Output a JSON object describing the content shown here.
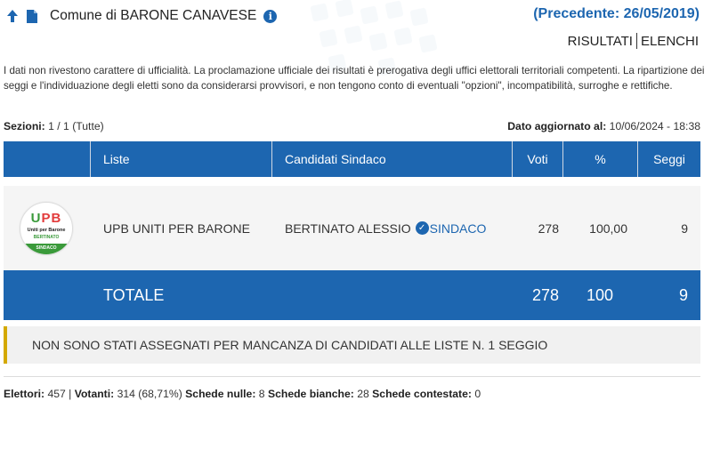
{
  "header": {
    "municipality_prefix": "Comune di",
    "municipality_name": "BARONE CANAVESE",
    "previous_label": "(Precedente: 26/05/2019)",
    "tabs": [
      {
        "label": "RISULTATI",
        "active": true
      },
      {
        "label": "ELENCHI",
        "active": false
      }
    ]
  },
  "disclaimer": "I dati non rivestono carattere di ufficialità. La proclamazione ufficiale dei risultati è prerogativa degli uffici elettorali territoriali competenti. La ripartizione dei seggi e l'individuazione degli eletti sono da considerarsi provvisori, e non tengono conto di eventuali \"opzioni\", incompatibilità, surroghe e rettifiche.",
  "sections": {
    "label": "Sezioni:",
    "value": "1 / 1 (Tutte)",
    "updated_label": "Dato aggiornato al:",
    "updated_value": "10/06/2024 - 18:38"
  },
  "table": {
    "headers": {
      "lists": "Liste",
      "candidates": "Candidati Sindaco",
      "votes": "Voti",
      "percent": "%",
      "seats": "Seggi"
    },
    "rows": [
      {
        "logo": {
          "letters_u": "U",
          "letters_p": "P",
          "letters_b": "B",
          "line1": "Uniti per Barone",
          "line2": "BERTINATO",
          "line3": "SINDACO"
        },
        "list": "UPB UNITI PER BARONE",
        "candidate": "BERTINATO ALESSIO",
        "elected_label": "SINDACO",
        "votes": "278",
        "percent": "100,00",
        "seats": "9"
      }
    ],
    "total": {
      "label": "TOTALE",
      "votes": "278",
      "percent": "100",
      "seats": "9"
    }
  },
  "notice": "NON SONO STATI ASSEGNATI PER MANCANZA DI CANDIDATI ALLE LISTE N. 1 SEGGIO",
  "footer": {
    "electors_label": "Elettori:",
    "electors_value": "457",
    "voters_label": "Votanti:",
    "voters_value": "314 (68,71%)",
    "null_label": "Schede nulle:",
    "null_value": "8",
    "blank_label": "Schede bianche:",
    "blank_value": "28",
    "contested_label": "Schede contestate:",
    "contested_value": "0"
  },
  "colors": {
    "primary": "#1d66b0",
    "notice_border": "#d4a900",
    "row_bg": "#f5f5f5"
  },
  "icons": [
    "arrow-up-icon",
    "document-icon",
    "info-icon",
    "check-circle-icon"
  ]
}
